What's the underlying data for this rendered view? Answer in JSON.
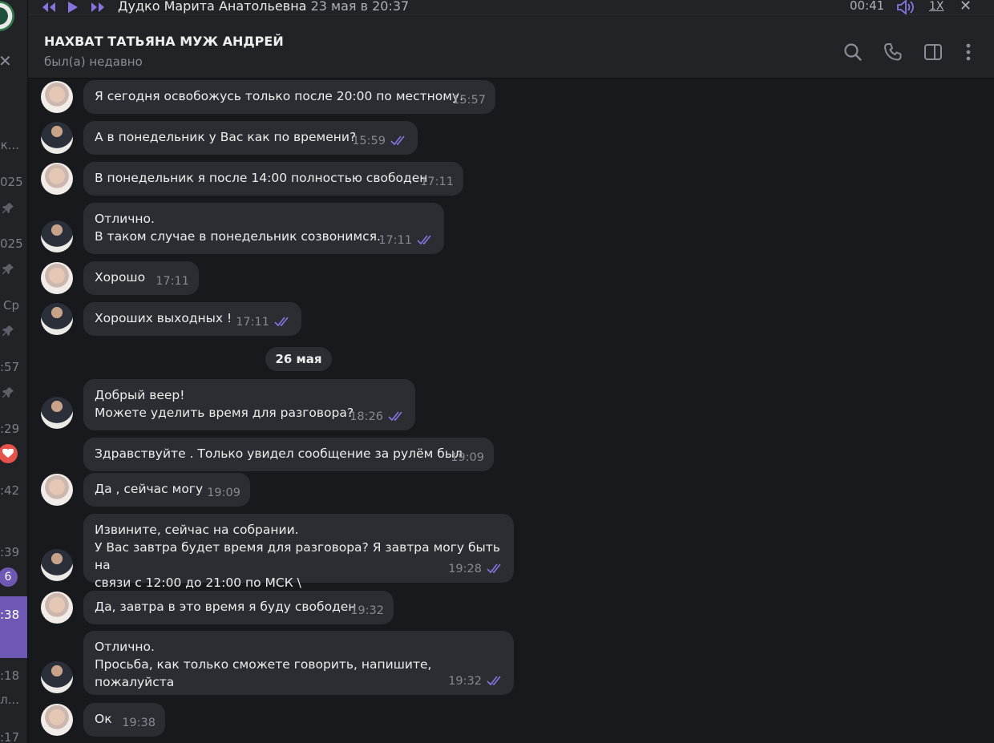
{
  "colors": {
    "accent": "#8774e1",
    "bubble": "#2b2d32",
    "background": "#17191d",
    "header": "#212327"
  },
  "left_strip": {
    "times": [
      "к...",
      "025",
      "025",
      "Ср",
      ":57",
      ":29",
      ":42",
      ":39",
      ":18",
      "л...",
      ":17"
    ],
    "active_time": ":38",
    "unread_badge": "6",
    "reaction": "heart-icon"
  },
  "player": {
    "author": "Дудко Марита Анатольевна",
    "date": "23 мая в 20:37",
    "time": "00:41",
    "speed": "1X"
  },
  "chat": {
    "title": "НАХВАТ ТАТЬЯНА МУЖ АНДРЕЙ",
    "status": "был(а) недавно"
  },
  "messages": [
    {
      "from": "contact",
      "text": "Я сегодня освобожусь только после 20:00 по местному.",
      "time": "15:57",
      "read": false
    },
    {
      "from": "me",
      "text": "А в понедельник у Вас как по времени?",
      "time": "15:59",
      "read": true
    },
    {
      "from": "contact",
      "text": "В понедельник я после 14:00 полностью свободен",
      "time": "17:11",
      "read": false
    },
    {
      "from": "me",
      "text": "Отлично.\nВ таком случае в понедельник созвонимся.",
      "time": "17:11",
      "read": true
    },
    {
      "from": "contact",
      "text": "Хорошо",
      "time": "17:11",
      "read": false
    },
    {
      "from": "me",
      "text": "Хороших выходных !",
      "time": "17:11",
      "read": true
    },
    {
      "from": "date",
      "text": "26 мая"
    },
    {
      "from": "me",
      "text": "Добрый веер!\nМожете уделить время для разговора?",
      "time": "18:26",
      "read": true
    },
    {
      "from": "contact",
      "text": "Здравствуйте . Только увидел сообщение за рулём был",
      "time": "19:09",
      "read": false
    },
    {
      "from": "contact",
      "text": "Да , сейчас могу",
      "time": "19:09",
      "read": false
    },
    {
      "from": "me",
      "text": "Извините, сейчас на собрании.\nУ Вас завтра будет время для разговора? Я завтра могу быть на\nсвязи с 12:00 до 21:00 по МСК \\",
      "time": "19:28",
      "read": true
    },
    {
      "from": "contact",
      "text": "Да, завтра в это время я буду свободен",
      "time": "19:32",
      "read": false
    },
    {
      "from": "me",
      "text": "Отлично.\nПросьба, как только сможете говорить, напишите, пожалуйста",
      "time": "19:32",
      "read": true
    },
    {
      "from": "contact",
      "text": "Ок",
      "time": "19:38",
      "read": false
    }
  ]
}
